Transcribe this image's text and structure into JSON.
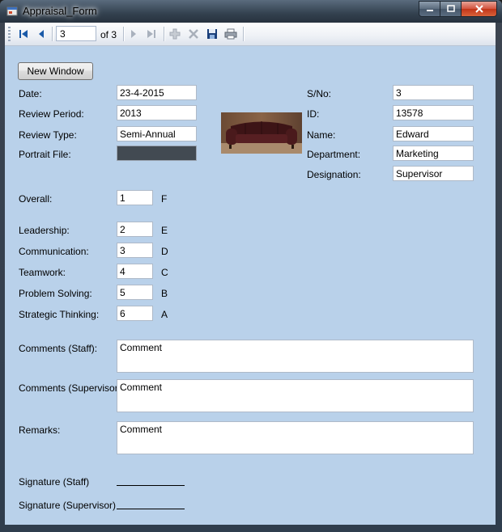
{
  "window": {
    "title": "Appraisal_Form"
  },
  "toolbar": {
    "position": "3",
    "of_label": "of 3"
  },
  "form": {
    "new_window_label": "New Window",
    "date_label": "Date:",
    "date_value": "23-4-2015",
    "review_period_label": "Review Period:",
    "review_period_value": "2013",
    "review_type_label": "Review Type:",
    "review_type_value": "Semi-Annual",
    "portrait_label": "Portrait File:",
    "portrait_value": "",
    "sno_label": "S/No:",
    "sno_value": "3",
    "id_label": "ID:",
    "id_value": "13578",
    "name_label": "Name:",
    "name_value": "Edward",
    "department_label": "Department:",
    "department_value": "Marketing",
    "designation_label": "Designation:",
    "designation_value": "Supervisor",
    "overall_label": "Overall:",
    "overall_value": "1",
    "overall_grade": "F",
    "ratings": [
      {
        "label": "Leadership:",
        "value": "2",
        "grade": "E"
      },
      {
        "label": "Communication:",
        "value": "3",
        "grade": "D"
      },
      {
        "label": "Teamwork:",
        "value": "4",
        "grade": "C"
      },
      {
        "label": "Problem Solving:",
        "value": "5",
        "grade": "B"
      },
      {
        "label": "Strategic Thinking:",
        "value": "6",
        "grade": "A"
      }
    ],
    "comments_staff_label": "Comments (Staff):",
    "comments_staff_value": "Comment",
    "comments_supervisor_label": "Comments (Supervisor):",
    "comments_supervisor_value": "Comment",
    "remarks_label": "Remarks:",
    "remarks_value": "Comment",
    "signature_staff_label": "Signature (Staff)",
    "signature_supervisor_label": "Signature (Supervisor)"
  },
  "colors": {
    "client_bg": "#b9d1ea",
    "portrait_box": "#424a52",
    "toolbar_icon": "#1a5aa8"
  },
  "icons": [
    "move-first-icon",
    "move-previous-icon",
    "move-next-icon",
    "move-last-icon",
    "add-new-icon",
    "delete-icon",
    "save-icon",
    "print-icon",
    "sofa-image"
  ]
}
